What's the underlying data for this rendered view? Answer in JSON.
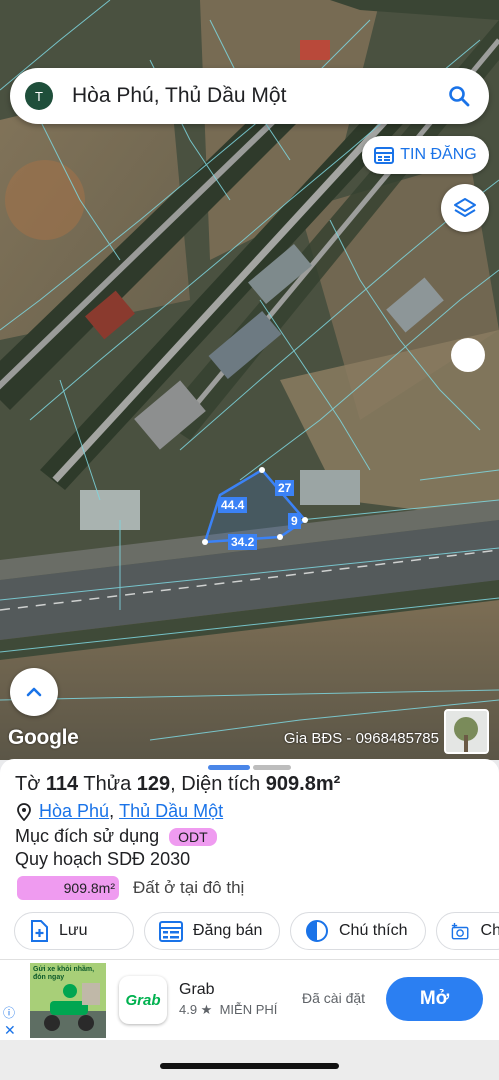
{
  "search": {
    "avatar_letter": "T",
    "query": "Hòa Phú, Thủ Dầu Một"
  },
  "map": {
    "tin_dang_label": "TIN ĐĂNG",
    "google_label": "Google",
    "watermark": "Gia BĐS - 0968485785",
    "plot_edges": [
      "44.4",
      "27",
      "9",
      "34.2"
    ]
  },
  "parcel": {
    "sheet_prefix": "Tờ",
    "sheet_no": "114",
    "lot_prefix": "Thửa",
    "lot_no": "129",
    "area_prefix": "Diện tích",
    "area": "909.8m²",
    "ward": "Hòa Phú",
    "city": "Thủ Dầu Một",
    "purpose_label": "Mục đích sử dụng",
    "purpose_code": "ODT",
    "plan_label": "Quy hoạch SDĐ 2030",
    "plan_area": "909.8m²",
    "plan_desc": "Đất ở tại đô thị"
  },
  "actions": [
    {
      "label": "Lưu",
      "icon": "add-note-icon"
    },
    {
      "label": "Đăng bán",
      "icon": "listing-icon"
    },
    {
      "label": "Chú thích",
      "icon": "contrast-icon"
    },
    {
      "label": "Ch",
      "icon": "add-photo-icon"
    }
  ],
  "ad": {
    "app_name": "Grab",
    "logo_text": "Grab",
    "rating": "4.9 ★",
    "price": "MIỄN PHÍ",
    "installed": "Đã cài đặt",
    "cta": "Mở",
    "banner_text": "Gửi xe khỏi nhầm, đón ngay"
  },
  "colors": {
    "accent": "#1a73e8",
    "plot": "#3b82f6",
    "zone": "#ef9bf0",
    "cta": "#2b7ff2"
  }
}
